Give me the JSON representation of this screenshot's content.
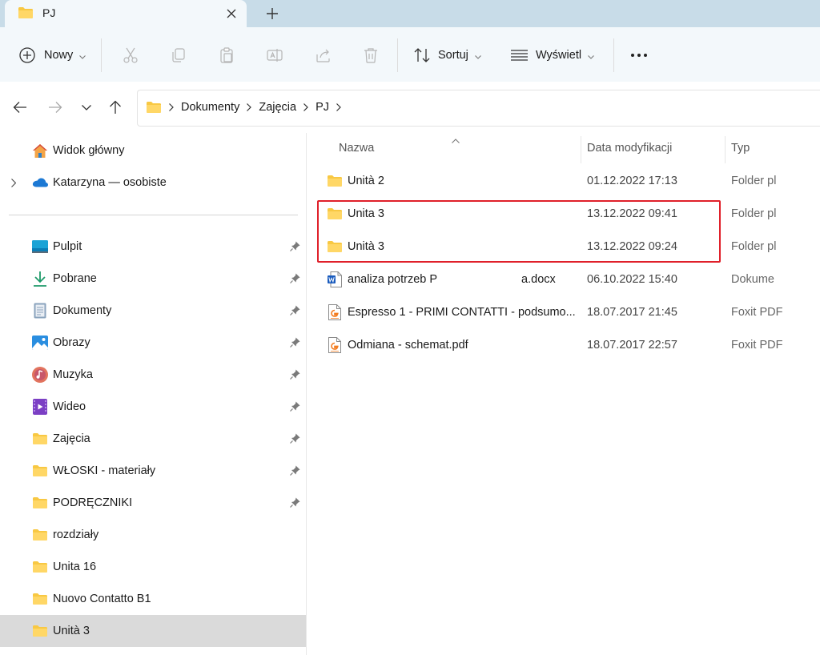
{
  "tab": {
    "title": "PJ"
  },
  "toolbar": {
    "new_label": "Nowy",
    "sort_label": "Sortuj",
    "view_label": "Wyświetl"
  },
  "breadcrumb": [
    "Dokumenty",
    "Zajęcia",
    "PJ"
  ],
  "sidebar": {
    "top_items": [
      {
        "label": "Widok główny",
        "icon": "home-icon"
      },
      {
        "label": "Katarzyna — osobiste",
        "icon": "onedrive-cloud-icon"
      }
    ],
    "items": [
      {
        "label": "Pulpit",
        "icon": "desktop-icon",
        "pinned": true
      },
      {
        "label": "Pobrane",
        "icon": "download-icon",
        "pinned": true
      },
      {
        "label": "Dokumenty",
        "icon": "documents-icon",
        "pinned": true
      },
      {
        "label": "Obrazy",
        "icon": "pictures-icon",
        "pinned": true
      },
      {
        "label": "Muzyka",
        "icon": "music-icon",
        "pinned": true
      },
      {
        "label": "Wideo",
        "icon": "video-icon",
        "pinned": true
      },
      {
        "label": "Zajęcia",
        "icon": "folder-icon",
        "pinned": true
      },
      {
        "label": "WŁOSKI - materiały",
        "icon": "folder-icon",
        "pinned": true
      },
      {
        "label": "PODRĘCZNIKI",
        "icon": "folder-icon",
        "pinned": true
      },
      {
        "label": "rozdziały",
        "icon": "folder-icon",
        "pinned": false
      },
      {
        "label": "Unita 16",
        "icon": "folder-icon",
        "pinned": false
      },
      {
        "label": "Nuovo Contatto B1",
        "icon": "folder-icon",
        "pinned": false
      },
      {
        "label": "Unità 3",
        "icon": "folder-icon",
        "pinned": false,
        "selected": true
      }
    ]
  },
  "columns": {
    "name": "Nazwa",
    "date": "Data modyfikacji",
    "type": "Typ"
  },
  "files": [
    {
      "name": "Unità 2",
      "date": "01.12.2022 17:13",
      "type": "Folder pl",
      "icon": "folder-icon"
    },
    {
      "name": "Unita 3",
      "date": "13.12.2022 09:41",
      "type": "Folder pl",
      "icon": "folder-icon"
    },
    {
      "name": "Unità 3",
      "date": "13.12.2022 09:24",
      "type": "Folder pl",
      "icon": "folder-icon"
    },
    {
      "name_start": "analiza potrzeb P",
      "name_end": "a.docx",
      "date": "06.10.2022 15:40",
      "type": "Dokume",
      "icon": "word-document-icon"
    },
    {
      "name": "Espresso 1 - PRIMI CONTATTI - podsumo...",
      "date": "18.07.2017 21:45",
      "type": "Foxit PDF",
      "icon": "pdf-icon"
    },
    {
      "name": "Odmiana - schemat.pdf",
      "date": "18.07.2017 22:57",
      "type": "Foxit PDF",
      "icon": "pdf-icon"
    }
  ],
  "colors": {
    "accent_blue": "#0067c0",
    "folder_yellow": "#f8c843",
    "highlight_red": "#e0202a",
    "selected_bg": "#dadada"
  }
}
